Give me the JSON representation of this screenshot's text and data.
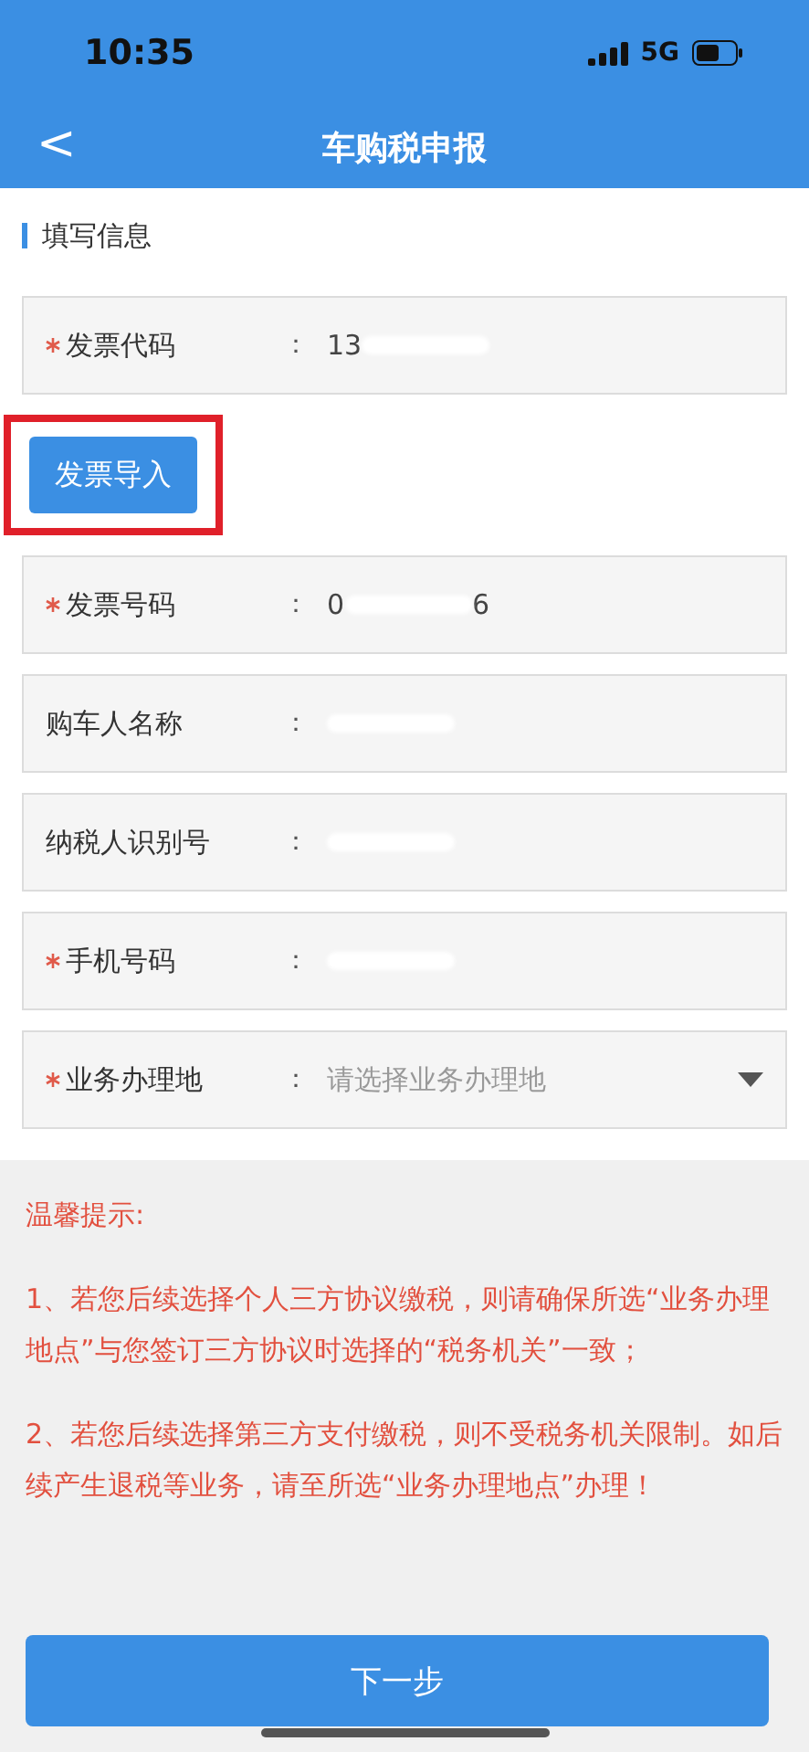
{
  "status_bar": {
    "time": "10:35",
    "network": "5G"
  },
  "nav": {
    "back": "<",
    "title": "车购税申报"
  },
  "section_title": "填写信息",
  "fields": [
    {
      "kind": "text",
      "label": "发票代码",
      "required": true,
      "colon": "：",
      "value_parts": [
        "13"
      ],
      "redacted": true
    },
    {
      "kind": "import_button",
      "label": "发票导入",
      "highlighted": true
    },
    {
      "kind": "text",
      "label": "发票号码",
      "required": true,
      "colon": "：",
      "value_parts": [
        "0",
        "6"
      ],
      "redacted": true
    },
    {
      "kind": "text",
      "label": "购车人名称",
      "required": false,
      "colon": "：",
      "redacted": true
    },
    {
      "kind": "text",
      "label": "纳税人识别号",
      "required": false,
      "colon": "：",
      "redacted": true
    },
    {
      "kind": "text",
      "label": "手机号码",
      "required": true,
      "colon": "：",
      "redacted": true
    },
    {
      "kind": "select",
      "label": "业务办理地",
      "required": true,
      "colon": "：",
      "placeholder": "请选择业务办理地"
    }
  ],
  "tips": {
    "title": "温馨提示:",
    "paragraphs": [
      "1、若您后续选择个人三方协议缴税，则请确保所选“业务办理地点”与您签订三方协议时选择的“税务机关”一致；",
      "2、若您后续选择第三方支付缴税，则不受税务机关限制。如后续产生退税等业务，请至所选“业务办理地点”办理！"
    ]
  },
  "next_button": "下一步"
}
